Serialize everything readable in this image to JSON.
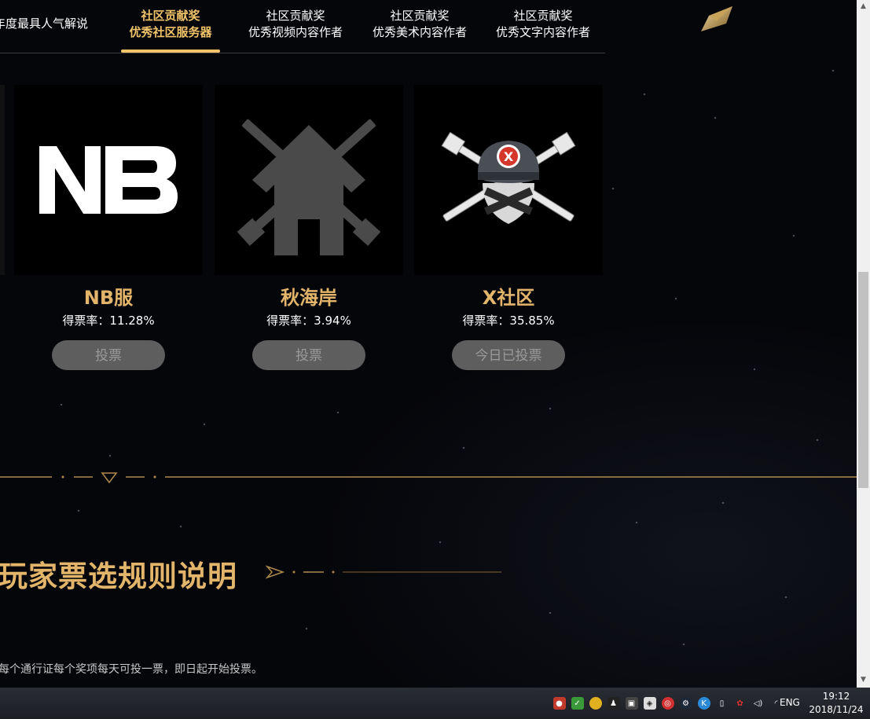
{
  "tabs": [
    {
      "line1": "年度最具人气解说",
      "line2": "",
      "active": false
    },
    {
      "line1": "社区贡献奖",
      "line2": "优秀社区服务器",
      "active": true
    },
    {
      "line1": "社区贡献奖",
      "line2": "优秀视频内容作者",
      "active": false
    },
    {
      "line1": "社区贡献奖",
      "line2": "优秀美术内容作者",
      "active": false
    },
    {
      "line1": "社区贡献奖",
      "line2": "优秀文字内容作者",
      "active": false
    }
  ],
  "candidates": [
    {
      "name": "NB服",
      "rate_label": "得票率：",
      "rate_value": "11.28%",
      "button": "投票"
    },
    {
      "name": "秋海岸",
      "rate_label": "得票率：",
      "rate_value": "3.94%",
      "button": "投票"
    },
    {
      "name": "X社区",
      "rate_label": "得票率：",
      "rate_value": "35.85%",
      "button": "今日已投票"
    }
  ],
  "logos": {
    "nb": "NB"
  },
  "section": {
    "title": "玩家票选规则说明",
    "rule_text": "每个通行证每个奖项每天可投一票，即日起开始投票。"
  },
  "taskbar": {
    "language": "ENG",
    "time": "19:12",
    "date": "2018/11/24",
    "tray_icons": [
      "security-icon",
      "shield-icon",
      "wechat-icon",
      "qq-icon",
      "tencent-icon",
      "game-icon",
      "netease-music-icon",
      "steam-icon",
      "kugou-icon",
      "usb-icon",
      "netease-icon",
      "volume-icon",
      "network-icon"
    ]
  },
  "colors": {
    "accent": "#e3b56a",
    "tab_active": "#f2c46a",
    "button_bg": "#5e5e5e"
  }
}
